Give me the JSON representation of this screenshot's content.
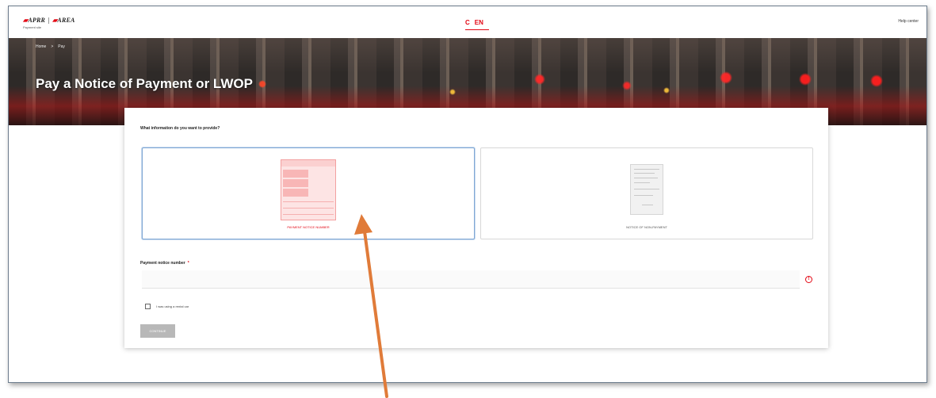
{
  "header": {
    "logo_left": "APRR",
    "logo_right": "AREA",
    "logo_sub": "Payment site",
    "lang_fr": "C",
    "lang_en": "EN",
    "help_link": "Help center"
  },
  "banner": {
    "breadcrumb": [
      "Home",
      ">",
      "Pay"
    ],
    "title": "Pay a Notice of Payment or LWOP"
  },
  "form": {
    "question": "What information do you want to provide?",
    "options": [
      {
        "label": "PAYMENT NOTICE NUMBER",
        "selected": true
      },
      {
        "label": "NOTICE OF NON-PAYMENT",
        "selected": false
      }
    ],
    "field_label": "Payment notice number",
    "required_mark": "*",
    "input_value": "",
    "error_icon": "!",
    "checkbox_label": "I was using a rental car",
    "checkbox_checked": false,
    "continue_label": "CONTINUE"
  },
  "colors": {
    "brand_red": "#e30613",
    "selection_blue": "#7fa7d4",
    "annotation_arrow": "#e07b39"
  },
  "icons": {
    "error": "error-circle-icon",
    "payment_doc": "payment-notice-document-icon",
    "non_payment_doc": "non-payment-document-icon"
  }
}
